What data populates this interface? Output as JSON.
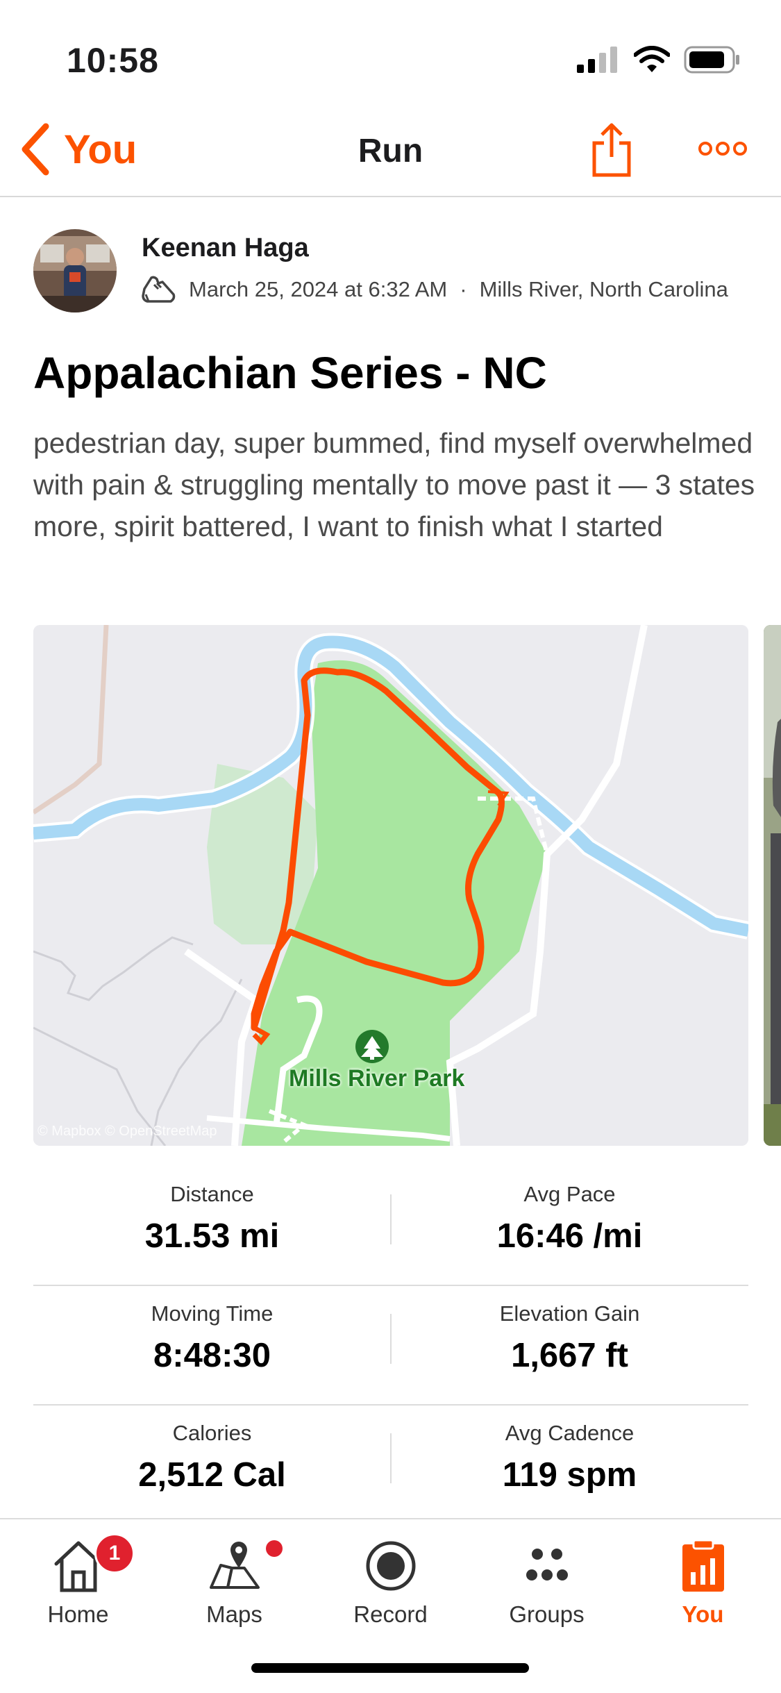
{
  "status_bar": {
    "time": "10:58"
  },
  "nav": {
    "back_label": "You",
    "title": "Run"
  },
  "athlete": {
    "name": "Keenan Haga",
    "date": "March 25, 2024 at 6:32 AM",
    "location": "Mills River, North Carolina",
    "separator": "·"
  },
  "activity": {
    "title": "Appalachian Series - NC",
    "description": "pedestrian day, super bummed, find myself overwhelmed with pain & struggling mentally to move past it — 3 states more, spirit battered, I want to finish what I started"
  },
  "map": {
    "park_label": "Mills River Park",
    "attribution": "© Mapbox © OpenStreetMap",
    "route_color": "#fc4c02",
    "water_color": "#a8d8f5",
    "park_color": "#a8e6a0"
  },
  "stats": [
    {
      "label": "Distance",
      "value": "31.53 mi"
    },
    {
      "label": "Avg Pace",
      "value": "16:46 /mi"
    },
    {
      "label": "Moving Time",
      "value": "8:48:30"
    },
    {
      "label": "Elevation Gain",
      "value": "1,667 ft"
    },
    {
      "label": "Calories",
      "value": "2,512 Cal"
    },
    {
      "label": "Avg Cadence",
      "value": "119 spm"
    }
  ],
  "tabs": [
    {
      "label": "Home",
      "icon": "home-icon",
      "badge": "1"
    },
    {
      "label": "Maps",
      "icon": "maps-icon"
    },
    {
      "label": "Record",
      "icon": "record-icon"
    },
    {
      "label": "Groups",
      "icon": "groups-icon"
    },
    {
      "label": "You",
      "icon": "you-icon",
      "active": true
    }
  ],
  "colors": {
    "accent": "#fc5200",
    "badge": "#e0212e"
  }
}
